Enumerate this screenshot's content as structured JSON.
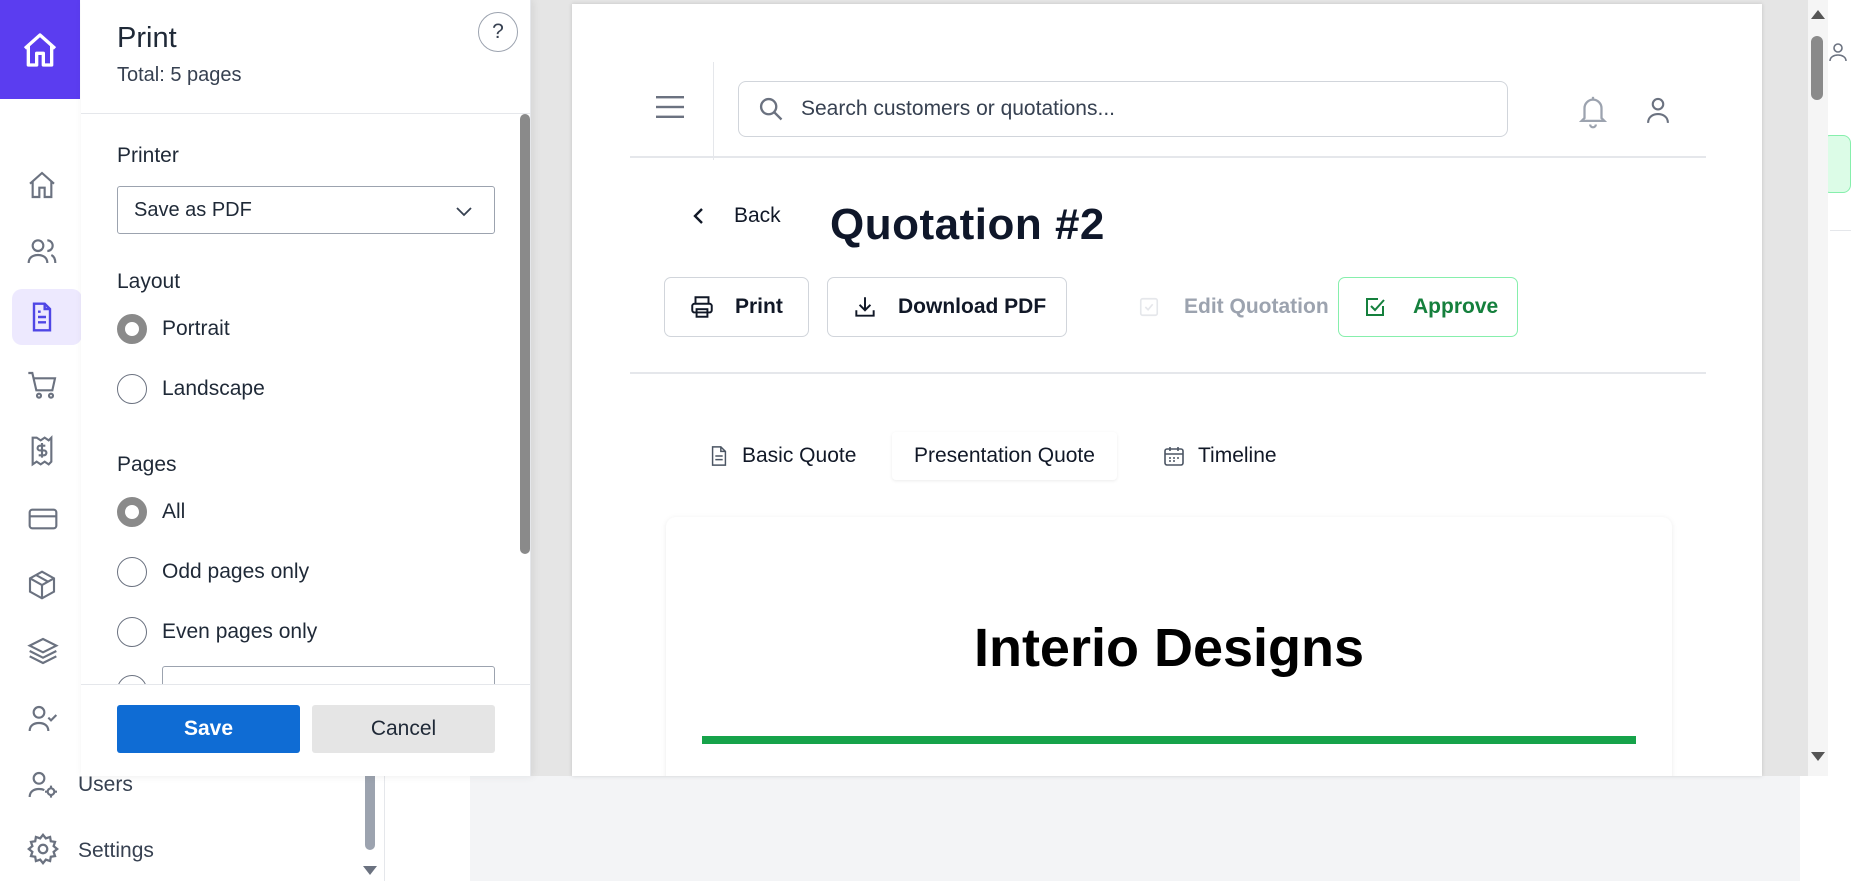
{
  "app": {
    "sidebar": {
      "items": [
        {
          "icon": "home-icon",
          "label": ""
        },
        {
          "icon": "users-icon",
          "label": ""
        },
        {
          "icon": "document-icon",
          "label": "",
          "active": true
        },
        {
          "icon": "cart-icon",
          "label": ""
        },
        {
          "icon": "receipt-icon",
          "label": ""
        },
        {
          "icon": "credit-card-icon",
          "label": ""
        },
        {
          "icon": "box-icon",
          "label": ""
        },
        {
          "icon": "layers-icon",
          "label": ""
        },
        {
          "icon": "user-check-icon",
          "label": ""
        },
        {
          "icon": "user-cog-icon",
          "label": "Users"
        },
        {
          "icon": "gear-icon",
          "label": "Settings"
        }
      ]
    },
    "accent_color": "#5b3df0"
  },
  "print_dialog": {
    "title": "Print",
    "total": "Total: 5 pages",
    "help": "?",
    "printer": {
      "label": "Printer",
      "value": "Save as PDF"
    },
    "layout": {
      "label": "Layout",
      "options": [
        "Portrait",
        "Landscape"
      ],
      "selected": "Portrait"
    },
    "pages": {
      "label": "Pages",
      "options": [
        "All",
        "Odd pages only",
        "Even pages only"
      ],
      "selected": "All"
    },
    "save_label": "Save",
    "cancel_label": "Cancel",
    "save_color": "#0f6cd4"
  },
  "preview": {
    "search_placeholder": "Search customers or quotations...",
    "back_label": "Back",
    "title": "Quotation #2",
    "actions": {
      "print": "Print",
      "download": "Download PDF",
      "edit": "Edit Quotation",
      "approve": "Approve"
    },
    "tabs": [
      "Basic Quote",
      "Presentation Quote",
      "Timeline"
    ],
    "active_tab": "Presentation Quote",
    "company_name": "Interio Designs",
    "brand_green": "#16a34a"
  }
}
